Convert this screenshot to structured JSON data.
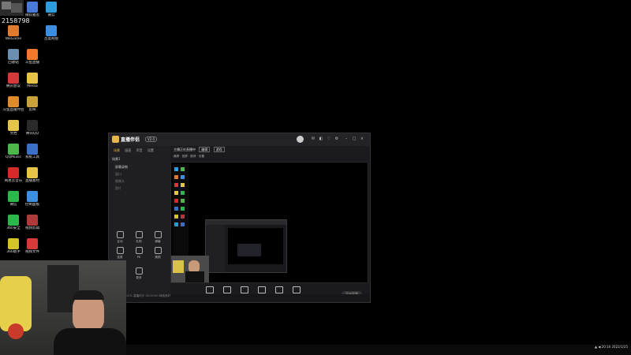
{
  "desktop": {
    "top_id": "2158798",
    "icons": [
      {
        "label": "微软雅黑",
        "color": "#4a7ad9"
      },
      {
        "label": "微云",
        "color": "#2d9de0"
      },
      {
        "label": "WeGame",
        "color": "#e07b2d"
      },
      {
        "label": "百度网盘",
        "color": "#3a8fe0"
      },
      {
        "label": "回收站",
        "color": "#6a8fb0"
      },
      {
        "label": "斗鱼直播",
        "color": "#f07a2a"
      },
      {
        "label": "腾讯会议",
        "color": "#d43a3a"
      },
      {
        "label": "Media",
        "color": "#e6c44a"
      },
      {
        "label": "斗鱼直播伴侣",
        "color": "#e08a2a"
      },
      {
        "label": "剪映",
        "color": "#c9a23a"
      },
      {
        "label": "文档",
        "color": "#e6c44a"
      },
      {
        "label": "腾讯QQ",
        "color": "#2a2a2a"
      },
      {
        "label": "QQMusic",
        "color": "#4ab84a"
      },
      {
        "label": "系统工具",
        "color": "#3a6fc9"
      },
      {
        "label": "网易云音乐",
        "color": "#d42a2a"
      },
      {
        "label": "直播素材",
        "color": "#e6c44a"
      },
      {
        "label": "微信",
        "color": "#2ab84a"
      },
      {
        "label": "控制面板",
        "color": "#3a8fe0"
      },
      {
        "label": "360安全",
        "color": "#2ab84a"
      },
      {
        "label": "视频剪辑",
        "color": "#b03a3a"
      },
      {
        "label": "360助手",
        "color": "#d4c42a"
      },
      {
        "label": "视频文件",
        "color": "#d43a3a"
      },
      {
        "label": "360软件管家",
        "color": "#2a9ad4"
      },
      {
        "label": "AnvilGame",
        "color": "#3a6fc9"
      },
      {
        "label": "Studio One",
        "color": "#555555"
      }
    ]
  },
  "app": {
    "logo_text": "直播伴侣",
    "version": "V2.0",
    "tabs": [
      "场景",
      "画面",
      "声音",
      "设置"
    ],
    "scenes": [
      "场景1",
      "屏幕录制",
      "窗口",
      "摄像头",
      "图片"
    ],
    "tools_row1": [
      "互动",
      "礼物",
      "弹幕"
    ],
    "tools_row2": [
      "连麦",
      "PK",
      "美颜"
    ],
    "tools_row3": [
      "直播间",
      "更多"
    ],
    "live_title": "主播正在直播中",
    "title_tag": "编辑",
    "category": "游戏",
    "preview_bar": [
      "横屏",
      "竖屏",
      "推荐",
      "设置"
    ],
    "bottom_items": [
      "屏幕",
      "摄像头",
      "窗口",
      "游戏",
      "麦克风",
      "扬声器"
    ],
    "start_label": "开始直播",
    "status_text": "FPS 30  CPU 12%  直播时长 00:00:00  网络良好"
  },
  "taskbar": {
    "time": "20:16",
    "date": "2022/1/25"
  }
}
